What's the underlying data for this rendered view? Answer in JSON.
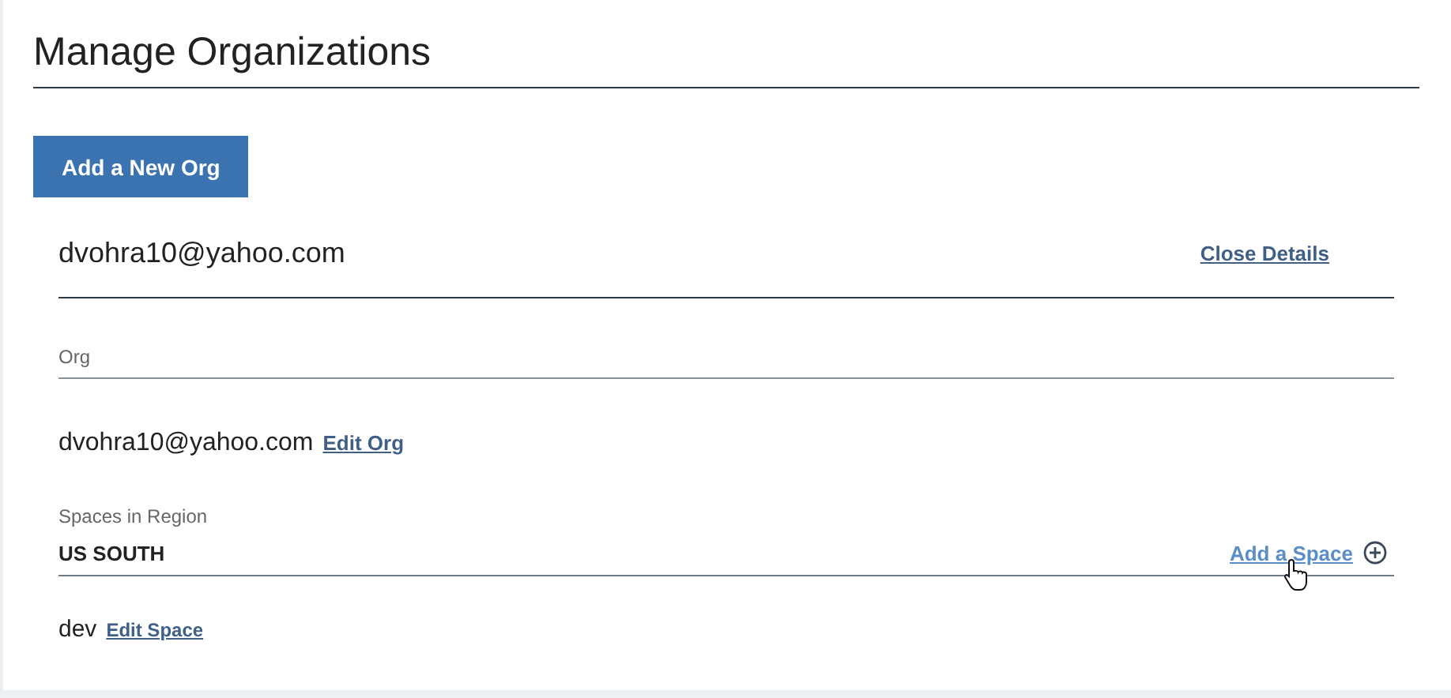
{
  "title": "Manage Organizations",
  "add_button": "Add a New Org",
  "org_card": {
    "name": "dvohra10@yahoo.com",
    "close_link": "Close Details",
    "org_label": "Org",
    "org_name": "dvohra10@yahoo.com",
    "edit_org": "Edit Org",
    "spaces_label": "Spaces in Region",
    "region": "US SOUTH",
    "add_space": {
      "label": "Add a Space",
      "hovered": true
    },
    "spaces": [
      {
        "name": "dev",
        "edit": "Edit Space"
      }
    ]
  }
}
